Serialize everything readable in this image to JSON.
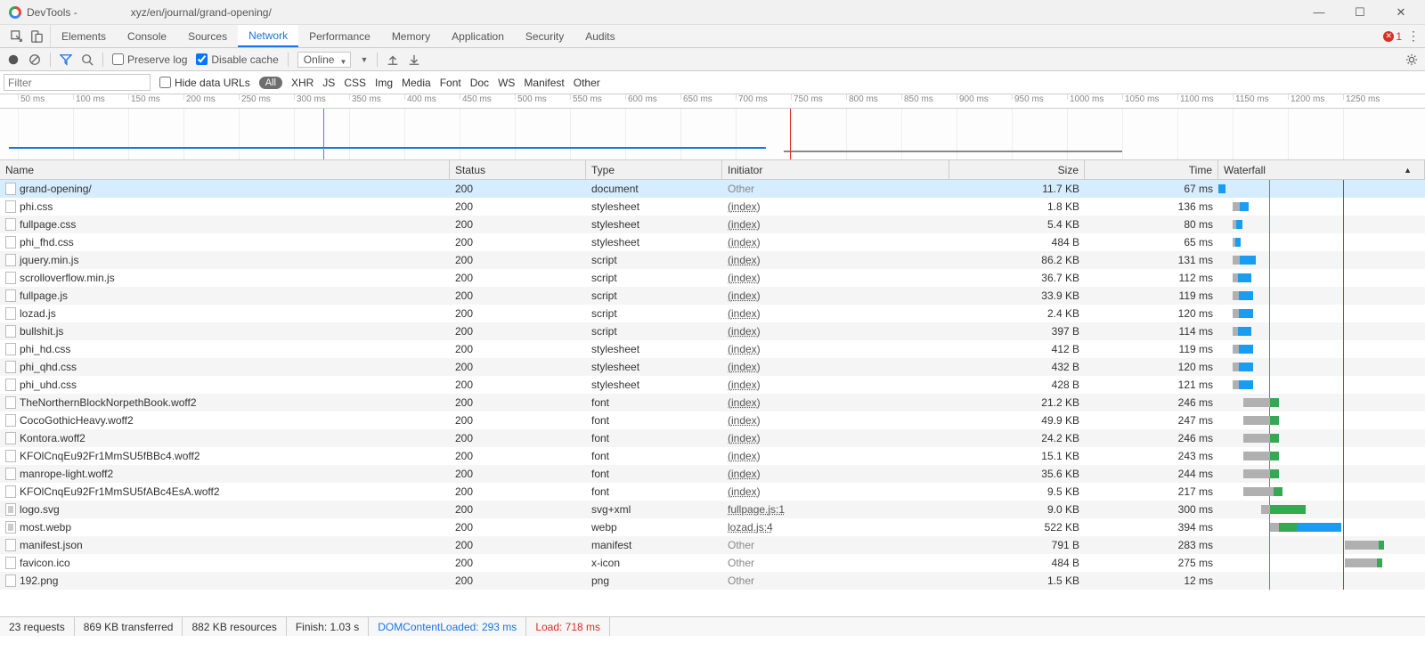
{
  "window": {
    "title": "DevTools -",
    "url": "xyz/en/journal/grand-opening/"
  },
  "tabs": [
    "Elements",
    "Console",
    "Sources",
    "Network",
    "Performance",
    "Memory",
    "Application",
    "Security",
    "Audits"
  ],
  "active_tab": "Network",
  "errors_count": "1",
  "toolbar": {
    "preserve_log": "Preserve log",
    "disable_cache": "Disable cache",
    "throttling": "Online"
  },
  "filter": {
    "placeholder": "Filter",
    "hide_data_urls": "Hide data URLs",
    "types": [
      "All",
      "XHR",
      "JS",
      "CSS",
      "Img",
      "Media",
      "Font",
      "Doc",
      "WS",
      "Manifest",
      "Other"
    ]
  },
  "timeline_ticks": [
    "50 ms",
    "100 ms",
    "150 ms",
    "200 ms",
    "250 ms",
    "300 ms",
    "350 ms",
    "400 ms",
    "450 ms",
    "500 ms",
    "550 ms",
    "600 ms",
    "650 ms",
    "700 ms",
    "750 ms",
    "800 ms",
    "850 ms",
    "900 ms",
    "950 ms",
    "1000 ms",
    "1050 ms",
    "1100 ms",
    "1150 ms",
    "1200 ms",
    "1250 ms"
  ],
  "columns": {
    "name": "Name",
    "status": "Status",
    "type": "Type",
    "initiator": "Initiator",
    "size": "Size",
    "time": "Time",
    "waterfall": "Waterfall"
  },
  "rows": [
    {
      "name": "grand-opening/",
      "status": "200",
      "type": "document",
      "initiator": "Other",
      "initiator_link": false,
      "size": "11.7 KB",
      "time": "67 ms",
      "selected": true,
      "wf": {
        "start": 0,
        "wait": 0,
        "dl": 8,
        "green": 0
      }
    },
    {
      "name": "phi.css",
      "status": "200",
      "type": "stylesheet",
      "initiator": "(index)",
      "initiator_link": true,
      "size": "1.8 KB",
      "time": "136 ms",
      "wf": {
        "start": 16,
        "wait": 8,
        "dl": 10,
        "green": 0
      }
    },
    {
      "name": "fullpage.css",
      "status": "200",
      "type": "stylesheet",
      "initiator": "(index)",
      "initiator_link": true,
      "size": "5.4 KB",
      "time": "80 ms",
      "wf": {
        "start": 16,
        "wait": 4,
        "dl": 7,
        "green": 0
      }
    },
    {
      "name": "phi_fhd.css",
      "status": "200",
      "type": "stylesheet",
      "initiator": "(index)",
      "initiator_link": true,
      "size": "484 B",
      "time": "65 ms",
      "wf": {
        "start": 16,
        "wait": 3,
        "dl": 6,
        "green": 0
      }
    },
    {
      "name": "jquery.min.js",
      "status": "200",
      "type": "script",
      "initiator": "(index)",
      "initiator_link": true,
      "size": "86.2 KB",
      "time": "131 ms",
      "wf": {
        "start": 16,
        "wait": 8,
        "dl": 18,
        "green": 0
      }
    },
    {
      "name": "scrolloverflow.min.js",
      "status": "200",
      "type": "script",
      "initiator": "(index)",
      "initiator_link": true,
      "size": "36.7 KB",
      "time": "112 ms",
      "wf": {
        "start": 16,
        "wait": 6,
        "dl": 15,
        "green": 0
      }
    },
    {
      "name": "fullpage.js",
      "status": "200",
      "type": "script",
      "initiator": "(index)",
      "initiator_link": true,
      "size": "33.9 KB",
      "time": "119 ms",
      "wf": {
        "start": 16,
        "wait": 7,
        "dl": 16,
        "green": 0
      }
    },
    {
      "name": "lozad.js",
      "status": "200",
      "type": "script",
      "initiator": "(index)",
      "initiator_link": true,
      "size": "2.4 KB",
      "time": "120 ms",
      "wf": {
        "start": 16,
        "wait": 7,
        "dl": 16,
        "green": 0
      }
    },
    {
      "name": "bullshit.js",
      "status": "200",
      "type": "script",
      "initiator": "(index)",
      "initiator_link": true,
      "size": "397 B",
      "time": "114 ms",
      "wf": {
        "start": 16,
        "wait": 6,
        "dl": 15,
        "green": 0
      }
    },
    {
      "name": "phi_hd.css",
      "status": "200",
      "type": "stylesheet",
      "initiator": "(index)",
      "initiator_link": true,
      "size": "412 B",
      "time": "119 ms",
      "wf": {
        "start": 16,
        "wait": 7,
        "dl": 16,
        "green": 0
      }
    },
    {
      "name": "phi_qhd.css",
      "status": "200",
      "type": "stylesheet",
      "initiator": "(index)",
      "initiator_link": true,
      "size": "432 B",
      "time": "120 ms",
      "wf": {
        "start": 16,
        "wait": 7,
        "dl": 16,
        "green": 0
      }
    },
    {
      "name": "phi_uhd.css",
      "status": "200",
      "type": "stylesheet",
      "initiator": "(index)",
      "initiator_link": true,
      "size": "428 B",
      "time": "121 ms",
      "wf": {
        "start": 16,
        "wait": 7,
        "dl": 16,
        "green": 0
      }
    },
    {
      "name": "TheNorthernBlockNorpethBook.woff2",
      "status": "200",
      "type": "font",
      "initiator": "(index)",
      "initiator_link": true,
      "size": "21.2 KB",
      "time": "246 ms",
      "wf": {
        "start": 28,
        "wait": 30,
        "dl": 0,
        "green": 10
      }
    },
    {
      "name": "CocoGothicHeavy.woff2",
      "status": "200",
      "type": "font",
      "initiator": "(index)",
      "initiator_link": true,
      "size": "49.9 KB",
      "time": "247 ms",
      "wf": {
        "start": 28,
        "wait": 30,
        "dl": 0,
        "green": 10
      }
    },
    {
      "name": "Kontora.woff2",
      "status": "200",
      "type": "font",
      "initiator": "(index)",
      "initiator_link": true,
      "size": "24.2 KB",
      "time": "246 ms",
      "wf": {
        "start": 28,
        "wait": 30,
        "dl": 0,
        "green": 10
      }
    },
    {
      "name": "KFOlCnqEu92Fr1MmSU5fBBc4.woff2",
      "status": "200",
      "type": "font",
      "initiator": "(index)",
      "initiator_link": true,
      "size": "15.1 KB",
      "time": "243 ms",
      "wf": {
        "start": 28,
        "wait": 30,
        "dl": 0,
        "green": 10
      }
    },
    {
      "name": "manrope-light.woff2",
      "status": "200",
      "type": "font",
      "initiator": "(index)",
      "initiator_link": true,
      "size": "35.6 KB",
      "time": "244 ms",
      "wf": {
        "start": 28,
        "wait": 30,
        "dl": 0,
        "green": 10
      }
    },
    {
      "name": "KFOlCnqEu92Fr1MmSU5fABc4EsA.woff2",
      "status": "200",
      "type": "font",
      "initiator": "(index)",
      "initiator_link": true,
      "size": "9.5 KB",
      "time": "217 ms",
      "wf": {
        "start": 28,
        "wait": 34,
        "dl": 0,
        "green": 10
      }
    },
    {
      "name": "logo.svg",
      "status": "200",
      "type": "svg+xml",
      "initiator": "fullpage.js:1",
      "initiator_link": true,
      "size": "9.0 KB",
      "time": "300 ms",
      "wf": {
        "start": 48,
        "wait": 10,
        "dl": 0,
        "green": 40
      },
      "imgicon": true
    },
    {
      "name": "most.webp",
      "status": "200",
      "type": "webp",
      "initiator": "lozad.js:4",
      "initiator_link": true,
      "size": "522 KB",
      "time": "394 ms",
      "wf": {
        "start": 58,
        "wait": 10,
        "dl": 50,
        "green": 20
      },
      "imgicon": true
    },
    {
      "name": "manifest.json",
      "status": "200",
      "type": "manifest",
      "initiator": "Other",
      "initiator_link": false,
      "size": "791 B",
      "time": "283 ms",
      "wf": {
        "start": 142,
        "wait": 38,
        "dl": 0,
        "green": 6
      }
    },
    {
      "name": "favicon.ico",
      "status": "200",
      "type": "x-icon",
      "initiator": "Other",
      "initiator_link": false,
      "size": "484 B",
      "time": "275 ms",
      "wf": {
        "start": 142,
        "wait": 36,
        "dl": 0,
        "green": 6
      }
    },
    {
      "name": "192.png",
      "status": "200",
      "type": "png",
      "initiator": "Other",
      "initiator_link": false,
      "size": "1.5 KB",
      "time": "12 ms",
      "wf": {
        "start": 0,
        "wait": 0,
        "dl": 0,
        "green": 0
      }
    }
  ],
  "status": {
    "requests": "23 requests",
    "transferred": "869 KB transferred",
    "resources": "882 KB resources",
    "finish": "Finish: 1.03 s",
    "dcl": "DOMContentLoaded: 293 ms",
    "load": "Load: 718 ms"
  }
}
